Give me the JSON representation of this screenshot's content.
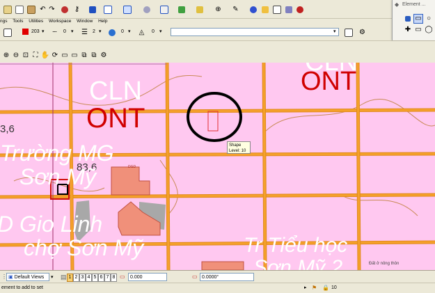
{
  "menu": [
    "ngs",
    "Tools",
    "Utilities",
    "Workspace",
    "Window",
    "Help"
  ],
  "attributes": {
    "color_value": "203",
    "color_swatch": "#e00000",
    "line_style_value": "0",
    "line_weight_value": "2",
    "fill_value": "0",
    "class_value": "0",
    "level_dropdown_value": ""
  },
  "element_panel": {
    "title": "Element ..."
  },
  "map": {
    "labels": {
      "cln": "CLN",
      "ont_left": "ONT",
      "ont_right": "ONT",
      "ont_top_right": "CLN",
      "num_left": "3,6",
      "num_center": "83,6",
      "school": "Trường MG",
      "son_my": "Sơn Mỹ",
      "gio_linh": "D Gio Linh",
      "cho_son_my": "chợ Sơn Mỹ",
      "tieu_hoc": "Tr Tiểu học",
      "son_my2": "Sơn Mỹ 2",
      "small_right": "Đất ở nông thôn",
      "small_center": "DGD"
    },
    "colors": {
      "land": "#ffc8f0",
      "road": "#f5a02a",
      "road_outline": "#e08a1c",
      "ont_text": "#d00000",
      "white_text": "#ffffff",
      "contour": "#c98a56"
    }
  },
  "tooltip": {
    "line1": "Shape",
    "line2": "Level: 10"
  },
  "statusbar": {
    "view_selector": "Default Views",
    "view_buttons": [
      "1",
      "2",
      "3",
      "4",
      "5",
      "6",
      "7",
      "8"
    ],
    "coord_x": "0.000",
    "angle": "0.0000°"
  },
  "bottombar": {
    "status_text": "ement to add to set",
    "level_value": "10"
  }
}
